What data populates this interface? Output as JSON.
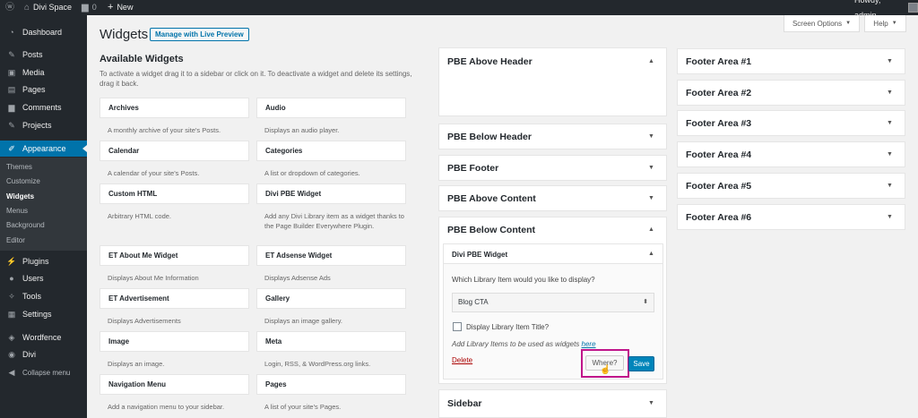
{
  "admin_bar": {
    "site_name": "Divi Space",
    "comments_count": "0",
    "new_label": "New",
    "howdy": "Howdy, admin"
  },
  "sidebar": {
    "items": [
      {
        "label": "Dashboard",
        "icon": "dashboard-icon"
      },
      {
        "label": "Posts",
        "icon": "pin-icon"
      },
      {
        "label": "Media",
        "icon": "media-icon"
      },
      {
        "label": "Pages",
        "icon": "pages-icon"
      },
      {
        "label": "Comments",
        "icon": "comments-icon"
      },
      {
        "label": "Projects",
        "icon": "projects-icon"
      },
      {
        "label": "Appearance",
        "icon": "brush-icon"
      },
      {
        "label": "Plugins",
        "icon": "plugin-icon"
      },
      {
        "label": "Users",
        "icon": "users-icon"
      },
      {
        "label": "Tools",
        "icon": "tools-icon"
      },
      {
        "label": "Settings",
        "icon": "settings-icon"
      },
      {
        "label": "Wordfence",
        "icon": "wordfence-icon"
      },
      {
        "label": "Divi",
        "icon": "divi-icon"
      },
      {
        "label": "Collapse menu",
        "icon": "collapse-icon"
      }
    ],
    "submenu": [
      "Themes",
      "Customize",
      "Widgets",
      "Menus",
      "Background",
      "Editor"
    ]
  },
  "header": {
    "title": "Widgets",
    "live_preview": "Manage with Live Preview",
    "screen_options": "Screen Options",
    "help": "Help"
  },
  "available": {
    "title": "Available Widgets",
    "description": "To activate a widget drag it to a sidebar or click on it. To deactivate a widget and delete its settings, drag it back.",
    "widgets": [
      {
        "name": "Archives",
        "desc": "A monthly archive of your site's Posts."
      },
      {
        "name": "Audio",
        "desc": "Displays an audio player."
      },
      {
        "name": "Calendar",
        "desc": "A calendar of your site's Posts."
      },
      {
        "name": "Categories",
        "desc": "A list or dropdown of categories."
      },
      {
        "name": "Custom HTML",
        "desc": "Arbitrary HTML code."
      },
      {
        "name": "Divi PBE Widget",
        "desc": "Add any Divi Library item as a widget thanks to the Page Builder Everywhere Plugin."
      },
      {
        "name": "ET About Me Widget",
        "desc": "Displays About Me Information"
      },
      {
        "name": "ET Adsense Widget",
        "desc": "Displays Adsense Ads"
      },
      {
        "name": "ET Advertisement",
        "desc": "Displays Advertisements"
      },
      {
        "name": "Gallery",
        "desc": "Displays an image gallery."
      },
      {
        "name": "Image",
        "desc": "Displays an image."
      },
      {
        "name": "Meta",
        "desc": "Login, RSS, & WordPress.org links."
      },
      {
        "name": "Navigation Menu",
        "desc": "Add a navigation menu to your sidebar."
      },
      {
        "name": "Pages",
        "desc": "A list of your site's Pages."
      }
    ]
  },
  "areas_left": {
    "pbe_above_header": "PBE Above Header",
    "pbe_below_header": "PBE Below Header",
    "pbe_footer": "PBE Footer",
    "pbe_above_content": "PBE Above Content",
    "pbe_below_content": "PBE Below Content",
    "sidebar": "Sidebar"
  },
  "divi_widget": {
    "title": "Divi PBE Widget",
    "question": "Which Library Item would you like to display?",
    "selected": "Blog CTA",
    "checkbox_label": "Display Library Item Title?",
    "add_items_text": "Add Library Items to be used as widgets",
    "add_items_link": "here",
    "delete": "Delete",
    "where": "Where?",
    "save": "Save"
  },
  "areas_right": [
    "Footer Area #1",
    "Footer Area #2",
    "Footer Area #3",
    "Footer Area #4",
    "Footer Area #5",
    "Footer Area #6"
  ],
  "colors": {
    "admin_bar": "#23282d",
    "accent": "#0073aa",
    "highlight": "#c0158a",
    "save": "#0085ba"
  }
}
